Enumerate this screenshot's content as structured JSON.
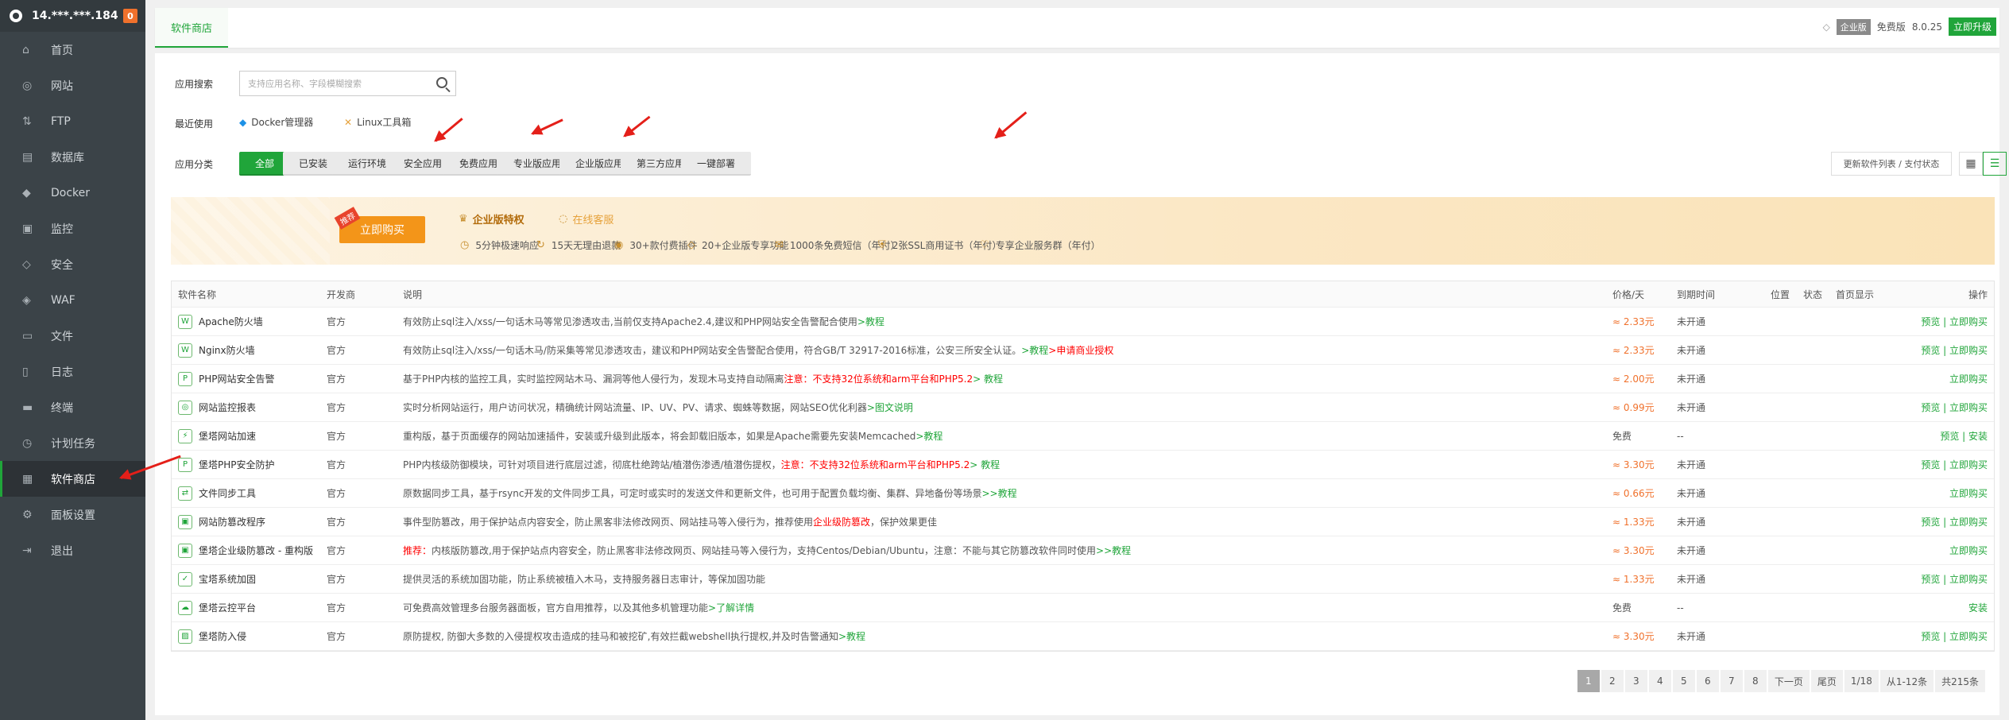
{
  "sidebar": {
    "host": "14.***.***.184",
    "badge": "0",
    "items": [
      {
        "label": "首页",
        "icon": "home-icon"
      },
      {
        "label": "网站",
        "icon": "globe-icon"
      },
      {
        "label": "FTP",
        "icon": "ftp-icon"
      },
      {
        "label": "数据库",
        "icon": "database-icon"
      },
      {
        "label": "Docker",
        "icon": "docker-icon"
      },
      {
        "label": "监控",
        "icon": "monitor-icon"
      },
      {
        "label": "安全",
        "icon": "shield-icon"
      },
      {
        "label": "WAF",
        "icon": "waf-icon"
      },
      {
        "label": "文件",
        "icon": "folder-icon"
      },
      {
        "label": "日志",
        "icon": "log-icon"
      },
      {
        "label": "终端",
        "icon": "terminal-icon"
      },
      {
        "label": "计划任务",
        "icon": "clock-icon"
      },
      {
        "label": "软件商店",
        "icon": "grid-icon"
      },
      {
        "label": "面板设置",
        "icon": "settings-icon"
      },
      {
        "label": "退出",
        "icon": "logout-icon"
      }
    ]
  },
  "topbar": {
    "tab": "软件商店",
    "edition": "企业版",
    "free": "免费版",
    "version": "8.0.25",
    "upgrade": "立即升级"
  },
  "search": {
    "label": "应用搜索",
    "placeholder": "支持应用名称、字段模糊搜索"
  },
  "recent": {
    "label": "最近使用",
    "items": [
      "Docker管理器",
      "Linux工具箱"
    ]
  },
  "categories": {
    "label": "应用分类",
    "items": [
      "全部",
      "已安装",
      "运行环境",
      "安全应用",
      "免费应用",
      "专业版应用",
      "企业版应用",
      "第三方应用",
      "一键部署"
    ],
    "refresh": "更新软件列表 / 支付状态"
  },
  "banner": {
    "tag": "推荐",
    "buy": "立即购买",
    "title": "企业版特权",
    "service": "在线客服",
    "features": [
      "5分钟极速响应",
      "15天无理由退款",
      "30+款付费插件",
      "20+企业版专享功能",
      "1000条免费短信（年付）",
      "2张SSL商用证书（年付）",
      "专享企业服务群（年付）"
    ]
  },
  "table": {
    "headers": {
      "name": "软件名称",
      "dev": "开发商",
      "desc": "说明",
      "price": "价格/天",
      "exp": "到期时间",
      "pos": "位置",
      "status": "状态",
      "home": "首页显示",
      "op": "操作"
    },
    "rows": [
      {
        "name": "Apache防火墙",
        "dev": "官方",
        "desc": "有效防止sql注入/xss/一句话木马等常见渗透攻击,当前仅支持Apache2.4,建议和PHP网站安全告警配合使用",
        "link": ">教程",
        "warn": "",
        "tail": "",
        "price": "≈ 2.33元",
        "exp": "未开通",
        "op": "预览 | 立即购买"
      },
      {
        "name": "Nginx防火墙",
        "dev": "官方",
        "desc": "有效防止sql注入/xss/一句话木马/防采集等常见渗透攻击，建议和PHP网站安全告警配合使用，符合GB/T 32917-2016标准，公安三所安全认证。",
        "link": ">教程",
        "warn": ">申请商业授权",
        "tail": "",
        "price": "≈ 2.33元",
        "exp": "未开通",
        "op": "预览 | 立即购买"
      },
      {
        "name": "PHP网站安全告警",
        "dev": "官方",
        "desc": "基于PHP内核的监控工具，实时监控网站木马、漏洞等他人侵行为，发现木马支持自动隔离",
        "link": "",
        "warn": "注意：不支持32位系统和arm平台和PHP5.2",
        "tail": "> 教程",
        "price": "≈ 2.00元",
        "exp": "未开通",
        "op": "立即购买"
      },
      {
        "name": "网站监控报表",
        "dev": "官方",
        "desc": "实时分析网站运行，用户访问状况，精确统计网站流量、IP、UV、PV、请求、蜘蛛等数据，网站SEO优化利器",
        "link": ">图文说明",
        "warn": "",
        "tail": "",
        "price": "≈ 0.99元",
        "exp": "未开通",
        "op": "预览 | 立即购买"
      },
      {
        "name": "堡塔网站加速",
        "dev": "官方",
        "desc": "重构版，基于页面缓存的网站加速插件，安装或升级到此版本，将会卸载旧版本，如果是Apache需要先安装Memcached",
        "link": ">教程",
        "warn": "",
        "tail": "",
        "price": "免费",
        "exp": "--",
        "op": "预览 | 安装"
      },
      {
        "name": "堡塔PHP安全防护",
        "dev": "官方",
        "desc": "PHP内核级防御模块，可针对项目进行底层过滤，彻底杜绝跨站/植潜伤渗透/植潜伤提权，",
        "link": "",
        "warn": "注意：不支持32位系统和arm平台和PHP5.2",
        "tail": "> 教程",
        "price": "≈ 3.30元",
        "exp": "未开通",
        "op": "预览 | 立即购买"
      },
      {
        "name": "文件同步工具",
        "dev": "官方",
        "desc": "原数据同步工具，基于rsync开发的文件同步工具，可定时或实时的发送文件和更新文件，也可用于配置负载均衡、集群、异地备份等场景",
        "link": ">>教程",
        "warn": "",
        "tail": "",
        "price": "≈ 0.66元",
        "exp": "未开通",
        "op": "立即购买"
      },
      {
        "name": "网站防篡改程序",
        "dev": "官方",
        "desc": "事件型防篡改，用于保护站点内容安全，防止黑客非法修改网页、网站挂马等入侵行为，推荐使用",
        "link": "",
        "warn": "企业级防篡改",
        "tail": "，保护效果更佳",
        "price": "≈ 1.33元",
        "exp": "未开通",
        "op": "预览 | 立即购买"
      },
      {
        "name": "堡塔企业级防篡改 - 重构版",
        "dev": "官方",
        "desc": "内核版防篡改,用于保护站点内容安全，防止黑客非法修改网页、网站挂马等入侵行为，支持Centos/Debian/Ubuntu，注意：不能与其它防篡改软件同时使用",
        "link": ">>教程",
        "warn": "推荐：",
        "tail": "",
        "price": "≈ 3.30元",
        "exp": "未开通",
        "op": "立即购买"
      },
      {
        "name": "宝塔系统加固",
        "dev": "官方",
        "desc": "提供灵活的系统加固功能，防止系统被植入木马，支持服务器日志审计，等保加固功能",
        "link": "",
        "warn": "",
        "tail": "",
        "price": "≈ 1.33元",
        "exp": "未开通",
        "op": "预览 | 立即购买"
      },
      {
        "name": "堡塔云控平台",
        "dev": "官方",
        "desc": "可免费高效管理多台服务器面板，官方自用推荐，以及其他多机管理功能",
        "link": ">了解详情",
        "warn": "",
        "tail": "",
        "price": "免费",
        "exp": "--",
        "op": "安装"
      },
      {
        "name": "堡塔防入侵",
        "dev": "官方",
        "desc": "原防提权, 防御大多数的入侵提权攻击造成的挂马和被挖矿,有效拦截webshell执行提权,并及时告警通知",
        "link": ">教程",
        "warn": "",
        "tail": "",
        "price": "≈ 3.30元",
        "exp": "未开通",
        "op": "预览 | 立即购买"
      }
    ]
  },
  "pager": {
    "pages": [
      "1",
      "2",
      "3",
      "4",
      "5",
      "6",
      "7",
      "8"
    ],
    "next": "下一页",
    "last": "尾页",
    "count": "1/18",
    "range": "从1-12条",
    "total": "共215条"
  }
}
